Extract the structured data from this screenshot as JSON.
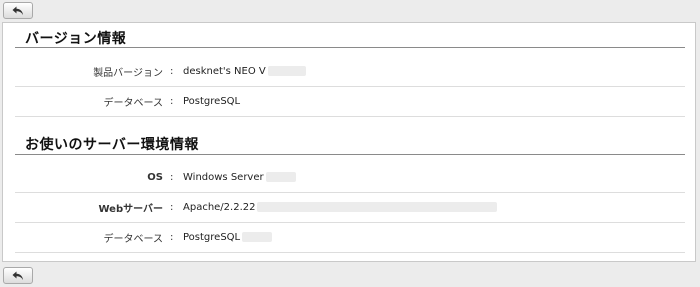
{
  "toolbar": {
    "back_label": "Back"
  },
  "sections": [
    {
      "title": "バージョン情報",
      "rows": [
        {
          "label": "製品バージョン",
          "colon": ":",
          "value": "desknet's NEO V"
        },
        {
          "label": "データベース",
          "colon": ":",
          "value": "PostgreSQL"
        }
      ]
    },
    {
      "title": "お使いのサーバー環境情報",
      "rows": [
        {
          "label": "OS",
          "colon": ":",
          "value": "Windows Server"
        },
        {
          "label": "Webサーバー",
          "colon": ":",
          "value": "Apache/2.2.22"
        },
        {
          "label": "データベース",
          "colon": ":",
          "value": "PostgreSQL"
        }
      ]
    }
  ],
  "colors": {
    "page_bg": "#ececec",
    "panel_bg": "#ffffff",
    "rule": "#8a8a8a",
    "row_divider": "#dddddd"
  },
  "icons": {
    "back": "undo-arrow-icon"
  }
}
